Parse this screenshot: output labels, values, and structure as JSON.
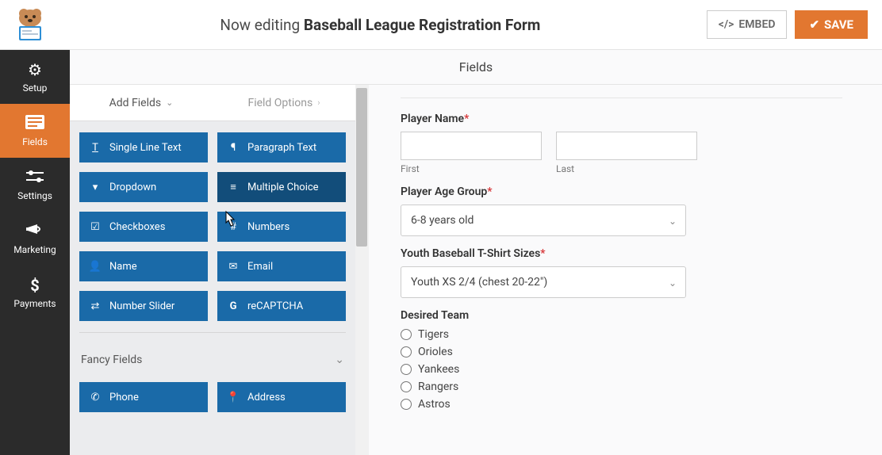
{
  "topbar": {
    "editing_prefix": "Now editing",
    "form_name": "Baseball League Registration Form",
    "embed_label": "EMBED",
    "save_label": "SAVE"
  },
  "sidenav": {
    "items": [
      {
        "label": "Setup",
        "icon": "gear"
      },
      {
        "label": "Fields",
        "icon": "form"
      },
      {
        "label": "Settings",
        "icon": "sliders"
      },
      {
        "label": "Marketing",
        "icon": "megaphone"
      },
      {
        "label": "Payments",
        "icon": "dollar"
      }
    ]
  },
  "section_header": "Fields",
  "panel": {
    "tab_add": "Add Fields",
    "tab_options": "Field Options",
    "standard_fields": [
      {
        "label": "Single Line Text",
        "icon": "text"
      },
      {
        "label": "Paragraph Text",
        "icon": "paragraph"
      },
      {
        "label": "Dropdown",
        "icon": "caret-sq"
      },
      {
        "label": "Multiple Choice",
        "icon": "list"
      },
      {
        "label": "Checkboxes",
        "icon": "check-sq"
      },
      {
        "label": "Numbers",
        "icon": "hash"
      },
      {
        "label": "Name",
        "icon": "user"
      },
      {
        "label": "Email",
        "icon": "envelope"
      },
      {
        "label": "Number Slider",
        "icon": "slider"
      },
      {
        "label": "reCAPTCHA",
        "icon": "google"
      }
    ],
    "fancy_toggle": "Fancy Fields",
    "fancy_fields": [
      {
        "label": "Phone",
        "icon": "phone"
      },
      {
        "label": "Address",
        "icon": "pin"
      }
    ]
  },
  "preview": {
    "playerName": {
      "label": "Player Name",
      "first": "First",
      "last": "Last"
    },
    "ageGroup": {
      "label": "Player Age Group",
      "value": "6-8 years old"
    },
    "tshirt": {
      "label": "Youth Baseball T-Shirt Sizes",
      "value": "Youth XS  2/4 (chest 20-22\")"
    },
    "team": {
      "label": "Desired Team",
      "options": [
        "Tigers",
        "Orioles",
        "Yankees",
        "Rangers",
        "Astros"
      ]
    }
  }
}
